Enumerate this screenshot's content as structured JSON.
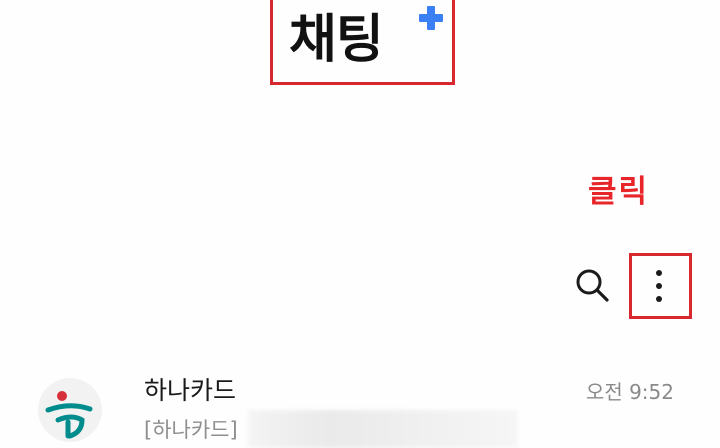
{
  "header": {
    "app_name": "채팅"
  },
  "annotation": {
    "click_label": "클릭"
  },
  "toolbar": {
    "search_icon": "search-icon",
    "more_icon": "more-vertical-icon"
  },
  "chat_list": [
    {
      "name": "하나카드",
      "time": "오전 9:52",
      "preview": "[하나카드]",
      "avatar_icon": "hana-logo-icon"
    }
  ],
  "colors": {
    "highlight_red": "#d7282f",
    "annotation_red": "#e8262a",
    "plus_blue": "#3a7ff3",
    "hana_green": "#008c8c",
    "hana_red": "#d6303a"
  }
}
